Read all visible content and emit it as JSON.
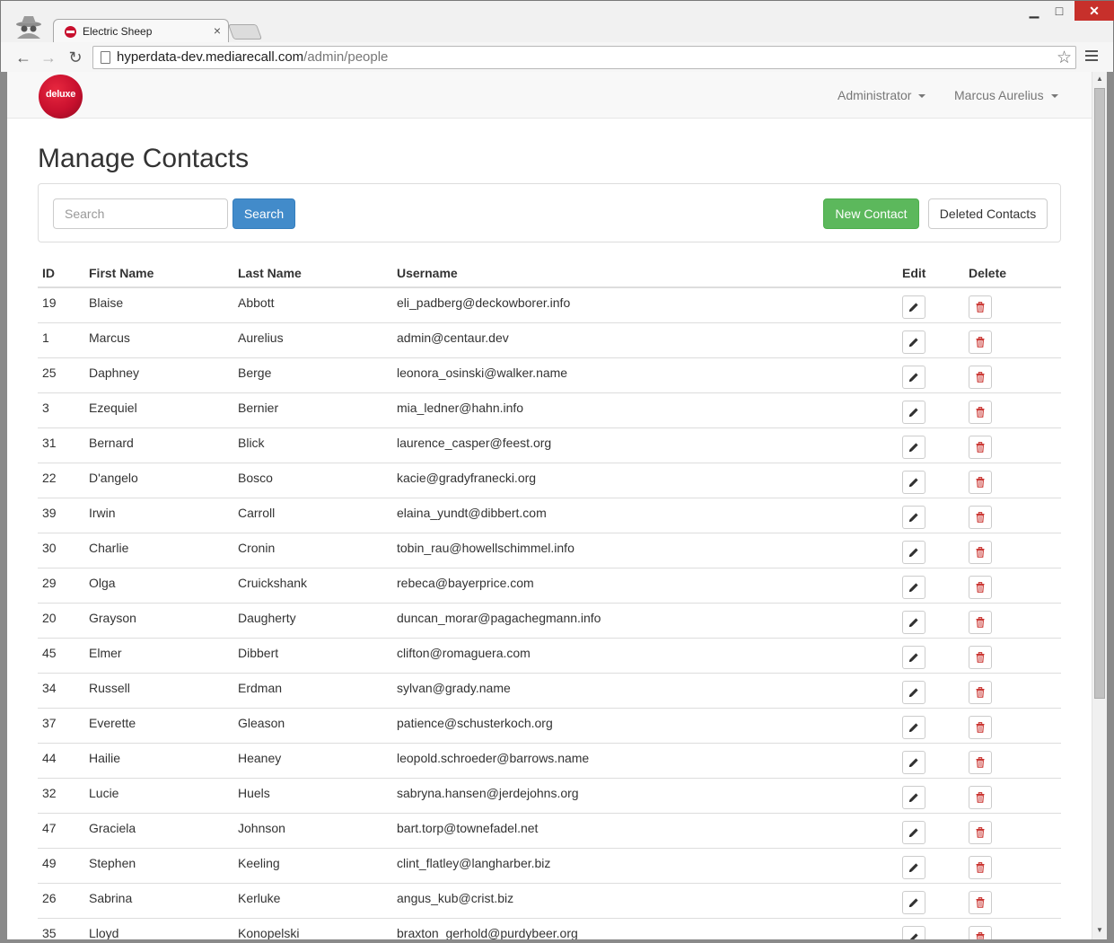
{
  "browser": {
    "tab_title": "Electric Sheep",
    "tab_close": "×",
    "url_host": "hyperdata-dev.mediarecall.com",
    "url_path": "/admin/people",
    "window_min": "▁",
    "window_max": "□",
    "window_close": "✕",
    "back": "←",
    "forward": "→",
    "reload": "↻",
    "star": "☆"
  },
  "navbar": {
    "logo_text": "deluxe",
    "menu_admin": "Administrator",
    "menu_user": "Marcus Aurelius"
  },
  "page": {
    "title": "Manage Contacts"
  },
  "controls": {
    "search_placeholder": "Search",
    "search_button": "Search",
    "new_contact_button": "New Contact",
    "deleted_contacts_button": "Deleted Contacts"
  },
  "table": {
    "headers": {
      "id": "ID",
      "first_name": "First Name",
      "last_name": "Last Name",
      "username": "Username",
      "edit": "Edit",
      "delete": "Delete"
    },
    "rows": [
      {
        "id": "19",
        "first": "Blaise",
        "last": "Abbott",
        "username": "eli_padberg@deckowborer.info"
      },
      {
        "id": "1",
        "first": "Marcus",
        "last": "Aurelius",
        "username": "admin@centaur.dev"
      },
      {
        "id": "25",
        "first": "Daphney",
        "last": "Berge",
        "username": "leonora_osinski@walker.name"
      },
      {
        "id": "3",
        "first": "Ezequiel",
        "last": "Bernier",
        "username": "mia_ledner@hahn.info"
      },
      {
        "id": "31",
        "first": "Bernard",
        "last": "Blick",
        "username": "laurence_casper@feest.org"
      },
      {
        "id": "22",
        "first": "D'angelo",
        "last": "Bosco",
        "username": "kacie@gradyfranecki.org"
      },
      {
        "id": "39",
        "first": "Irwin",
        "last": "Carroll",
        "username": "elaina_yundt@dibbert.com"
      },
      {
        "id": "30",
        "first": "Charlie",
        "last": "Cronin",
        "username": "tobin_rau@howellschimmel.info"
      },
      {
        "id": "29",
        "first": "Olga",
        "last": "Cruickshank",
        "username": "rebeca@bayerprice.com"
      },
      {
        "id": "20",
        "first": "Grayson",
        "last": "Daugherty",
        "username": "duncan_morar@pagachegmann.info"
      },
      {
        "id": "45",
        "first": "Elmer",
        "last": "Dibbert",
        "username": "clifton@romaguera.com"
      },
      {
        "id": "34",
        "first": "Russell",
        "last": "Erdman",
        "username": "sylvan@grady.name"
      },
      {
        "id": "37",
        "first": "Everette",
        "last": "Gleason",
        "username": "patience@schusterkoch.org"
      },
      {
        "id": "44",
        "first": "Hailie",
        "last": "Heaney",
        "username": "leopold.schroeder@barrows.name"
      },
      {
        "id": "32",
        "first": "Lucie",
        "last": "Huels",
        "username": "sabryna.hansen@jerdejohns.org"
      },
      {
        "id": "47",
        "first": "Graciela",
        "last": "Johnson",
        "username": "bart.torp@townefadel.net"
      },
      {
        "id": "49",
        "first": "Stephen",
        "last": "Keeling",
        "username": "clint_flatley@langharber.biz"
      },
      {
        "id": "26",
        "first": "Sabrina",
        "last": "Kerluke",
        "username": "angus_kub@crist.biz"
      },
      {
        "id": "35",
        "first": "Lloyd",
        "last": "Konopelski",
        "username": "braxton_gerhold@purdybeer.org"
      }
    ]
  },
  "colors": {
    "primary": "#428bca",
    "success": "#5cb85c",
    "danger": "#c9302c",
    "brand": "#c8102e"
  },
  "icons": {
    "edit": "pencil-icon",
    "delete": "trash-icon"
  }
}
